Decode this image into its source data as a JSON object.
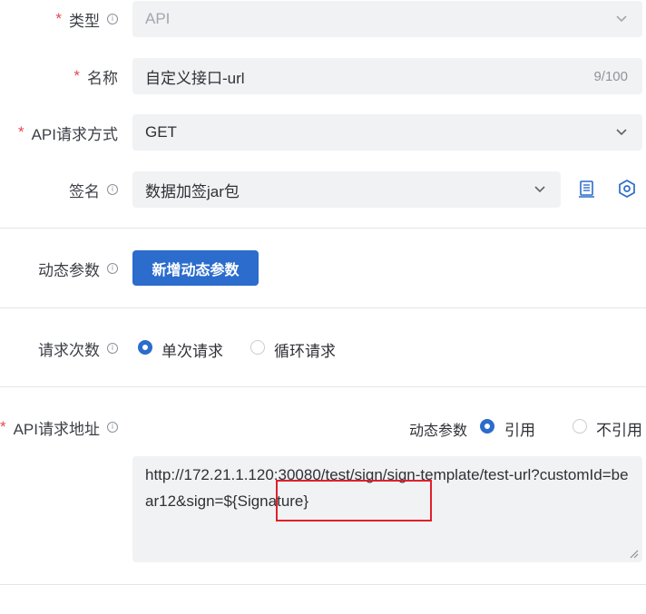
{
  "form": {
    "type": {
      "label": "类型",
      "required": "*",
      "info": "i",
      "value": "API"
    },
    "name": {
      "label": "名称",
      "required": "*",
      "value": "自定义接口-url",
      "count": "9/100"
    },
    "method": {
      "label": "API请求方式",
      "required": "*",
      "value": "GET"
    },
    "signature": {
      "label": "签名",
      "info": "i",
      "value": "数据加签jar包"
    },
    "dynamic_params": {
      "label": "动态参数",
      "info": "i",
      "add_button": "新增动态参数"
    },
    "request_count": {
      "label": "请求次数",
      "info": "i",
      "options": [
        {
          "label": "单次请求",
          "selected": true
        },
        {
          "label": "循环请求",
          "selected": false
        }
      ]
    },
    "api_url": {
      "label": "API请求地址",
      "required": "*",
      "info": "i",
      "dynamic_label": "动态参数",
      "options": [
        {
          "label": "引用",
          "selected": true
        },
        {
          "label": "不引用",
          "selected": false
        }
      ],
      "value": "http://172.21.1.120:30080/test/sign/sign-template/test-url?customId=bear12&sign=${Signature}"
    }
  },
  "icons": [
    "chevron-down-icon",
    "document-icon",
    "settings-icon",
    "info-icon",
    "resize-handle-icon"
  ],
  "colors": {
    "accent": "#2b6ccc",
    "required": "#e5484d",
    "field_bg": "#f1f2f4",
    "highlight_box": "#e0202a"
  }
}
